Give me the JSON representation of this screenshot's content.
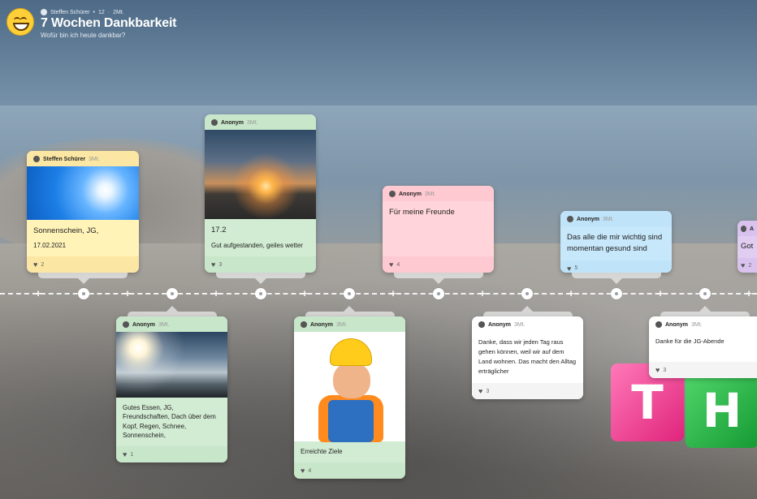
{
  "header": {
    "author": "Steffen Schürer",
    "count": "12",
    "age": "2Mt.",
    "title": "7 Wochen Dankbarkeit",
    "subtitle": "Wofür bin ich heute dankbar?"
  },
  "posts": [
    {
      "author": "Steffen Schürer",
      "time": "3Mt.",
      "text": "Sonnenschein, JG,",
      "text2": "17.02.2021",
      "likes": "2"
    },
    {
      "author": "Anonym",
      "time": "3Mt.",
      "text": "Gutes Essen, JG, Freundschaften, Dach über dem Kopf, Regen, Schnee, Sonnenschein,",
      "likes": "1"
    },
    {
      "author": "Anonym",
      "time": "3Mt.",
      "text": "17.2",
      "text2": "Gut aufgestanden, geiles wetter",
      "likes": "3"
    },
    {
      "author": "Anonym",
      "time": "3Mt.",
      "text": "Erreichte Ziele",
      "likes": "4"
    },
    {
      "author": "Anonym",
      "time": "3Mt.",
      "text": "Für meine Freunde",
      "likes": "4"
    },
    {
      "author": "Anonym",
      "time": "3Mt.",
      "text": "Danke, dass wir jeden Tag raus gehen können, weil wir auf dem Land wohnen. Das macht den Alltag erträglicher",
      "likes": "3"
    },
    {
      "author": "Anonym",
      "time": "3Mt.",
      "text": "Das alle die mir wichtig sind momentan gesund sind",
      "likes": "5"
    },
    {
      "author": "Anonym",
      "time": "3Mt.",
      "text": "Danke für die JG-Abende",
      "likes": "3"
    },
    {
      "author": "A",
      "time": "",
      "text": "Got",
      "likes": "2"
    }
  ],
  "blocks": {
    "left": "T",
    "right": "H"
  },
  "colors": {
    "yellow": "#fff3b8",
    "green": "#d2ecd3",
    "pink": "#ffd4da",
    "blue": "#c7e7fa",
    "white": "#ffffff",
    "purple": "#e0cdf1"
  }
}
